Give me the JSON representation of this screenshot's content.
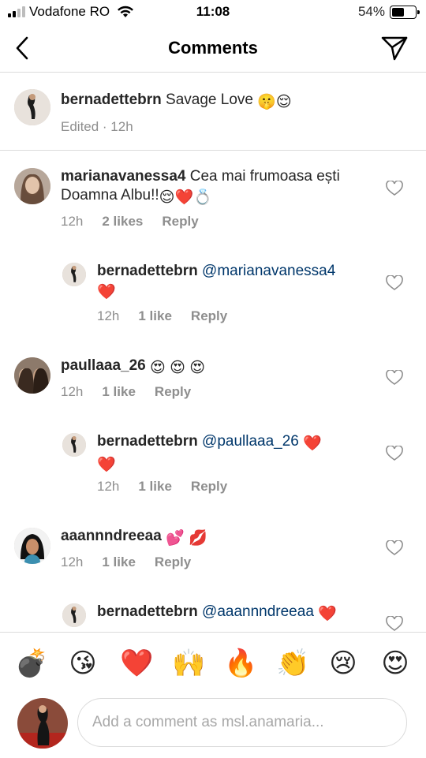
{
  "status_bar": {
    "carrier": "Vodafone RO",
    "time": "11:08",
    "battery": "54%",
    "battery_level": 0.54
  },
  "header": {
    "title": "Comments",
    "back_icon": "chevron-left-icon",
    "share_icon": "paper-plane-icon"
  },
  "caption": {
    "username": "bernadettebrn",
    "text": "Savage Love",
    "emojis": "🤫😌",
    "meta": "Edited · 12h"
  },
  "comments": [
    {
      "username": "marianavanessa4",
      "text_line1": "Cea mai frumoasa ești",
      "text_line2": "Doamna Albu!!",
      "emojis": "😌❤️💍",
      "time": "12h",
      "likes": "2 likes",
      "reply": "Reply"
    },
    {
      "username": "bernadettebrn",
      "mention": "@marianavanessa4",
      "emojis": "❤️",
      "time": "12h",
      "likes": "1 like",
      "reply": "Reply"
    },
    {
      "username": "paullaaa_26",
      "emojis": "😍 😍 😍",
      "time": "12h",
      "likes": "1 like",
      "reply": "Reply"
    },
    {
      "username": "bernadettebrn",
      "mention": "@paullaaa_26",
      "emojis_inline": "❤️",
      "emojis": "❤️",
      "time": "12h",
      "likes": "1 like",
      "reply": "Reply"
    },
    {
      "username": "aaannndreeaa",
      "emojis": "💕 💋",
      "time": "12h",
      "likes": "1 like",
      "reply": "Reply"
    },
    {
      "username": "bernadettebrn",
      "mention": "@aaannndreeaa",
      "emojis": "❤️"
    }
  ],
  "emoji_bar": [
    "💣",
    "😘",
    "❤️",
    "🙌",
    "🔥",
    "👏",
    "😢",
    "😍"
  ],
  "composer": {
    "placeholder": "Add a comment as msl.anamaria..."
  },
  "colors": {
    "text": "#262626",
    "secondary": "#8e8e8e",
    "mention": "#00376b",
    "divider": "#dbdbdb"
  }
}
